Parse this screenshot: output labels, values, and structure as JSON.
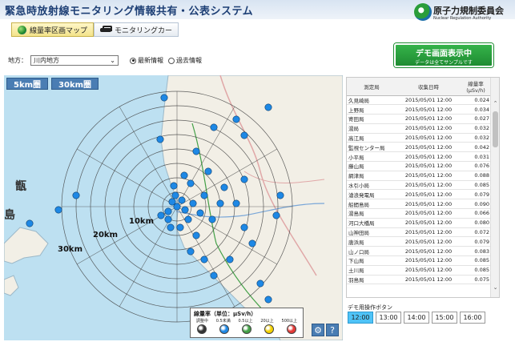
{
  "header": {
    "title": "緊急時放射線モニタリング情報共有・公表システム",
    "org_name": "原子力規制委員会",
    "org_name_en": "Nuclear Regulation Authority"
  },
  "tabs": [
    {
      "label": "線量率区画マップ",
      "active": true
    },
    {
      "label": "モニタリングカー",
      "active": false
    }
  ],
  "area": {
    "label": "地方：",
    "selected": "川内地方"
  },
  "mode": {
    "latest": "最新情報",
    "past": "過去情報"
  },
  "demo_banner": {
    "title": "デモ画面表示中",
    "subtitle": "データは全てサンプルです"
  },
  "map": {
    "range_buttons": [
      "5km圏",
      "30km圏"
    ],
    "ring_labels": [
      "10km",
      "20km",
      "30km"
    ],
    "place_labels": [
      "甑",
      "島"
    ],
    "legend": {
      "title": "線量率（単位：μSv/h）",
      "categories": [
        "調整中",
        "0.5未満",
        "0.5以上",
        "20以上",
        "500以上"
      ],
      "colors": [
        "#333333",
        "#1e88e5",
        "#43a047",
        "#f5d300",
        "#e53935"
      ]
    },
    "help_label": "?"
  },
  "table": {
    "headers": [
      "測定局",
      "収集日時",
      "線量率\n(μSv/h)"
    ],
    "rows": [
      [
        "久見崎局",
        "2015/05/01 12:00",
        "0.024"
      ],
      [
        "上野局",
        "2015/05/01 12:00",
        "0.034"
      ],
      [
        "寄田局",
        "2015/05/01 12:00",
        "0.027"
      ],
      [
        "湯局",
        "2015/05/01 12:00",
        "0.032"
      ],
      [
        "高江局",
        "2015/05/01 12:00",
        "0.032"
      ],
      [
        "監視センター局",
        "2015/05/01 12:00",
        "0.042"
      ],
      [
        "小平局",
        "2015/05/01 12:00",
        "0.031"
      ],
      [
        "藤山局",
        "2015/05/01 12:00",
        "0.076"
      ],
      [
        "網津局",
        "2015/05/01 12:00",
        "0.088"
      ],
      [
        "水引小局",
        "2015/05/01 12:00",
        "0.085"
      ],
      [
        "滄浪発電局",
        "2015/05/01 12:00",
        "0.079"
      ],
      [
        "船間島局",
        "2015/05/01 12:00",
        "0.090"
      ],
      [
        "湯島局",
        "2015/05/01 12:00",
        "0.066"
      ],
      [
        "河口大橋局",
        "2015/05/01 12:00",
        "0.080"
      ],
      [
        "山神田局",
        "2015/05/01 12:00",
        "0.072"
      ],
      [
        "唐浜局",
        "2015/05/01 12:00",
        "0.079"
      ],
      [
        "山ノ口局",
        "2015/05/01 12:00",
        "0.083"
      ],
      [
        "下山局",
        "2015/05/01 12:00",
        "0.085"
      ],
      [
        "土川局",
        "2015/05/01 12:00",
        "0.085"
      ],
      [
        "羽島局",
        "2015/05/01 12:00",
        "0.075"
      ]
    ]
  },
  "demo_ops": {
    "label": "デモ用操作ボタン",
    "times": [
      "12:00",
      "13:00",
      "14:00",
      "15:00",
      "16:00"
    ],
    "active_index": 0
  }
}
